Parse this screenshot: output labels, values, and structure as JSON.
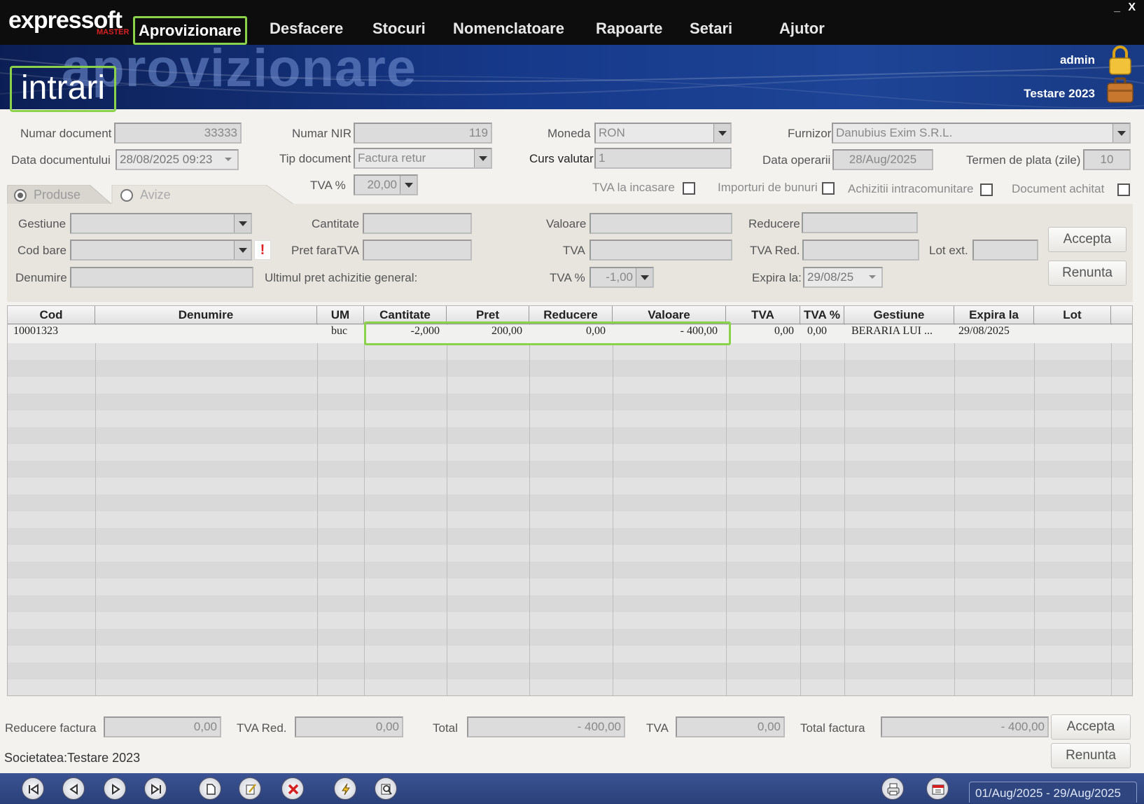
{
  "app": {
    "logo": "expressoft",
    "logo_sub": "MASTER",
    "window_min": "_",
    "window_close": "X"
  },
  "menu": {
    "items": [
      "Aprovizionare",
      "Desfacere",
      "Stocuri",
      "Nomenclatoare",
      "Rapoarte",
      "Setari",
      "Ajutor"
    ],
    "active": "Aprovizionare"
  },
  "banner": {
    "bg_title": "aprovizionare",
    "section_title": "intrari",
    "user": "admin",
    "company": "Testare 2023"
  },
  "header_form": {
    "numar_document": {
      "label": "Numar document",
      "value": "33333"
    },
    "numar_nir": {
      "label": "Numar NIR",
      "value": "119"
    },
    "moneda": {
      "label": "Moneda",
      "value": "RON"
    },
    "furnizor": {
      "label": "Furnizor",
      "value": "Danubius Exim S.R.L."
    },
    "data_documentului": {
      "label": "Data documentului",
      "value": "28/08/2025 09:23"
    },
    "tip_document": {
      "label": "Tip document",
      "value": "Factura retur"
    },
    "curs_valutar": {
      "label": "Curs valutar",
      "value": "1"
    },
    "data_operarii": {
      "label": "Data operarii",
      "value": "28/Aug/2025"
    },
    "termen_plata": {
      "label": "Termen de plata (zile)",
      "value": "10"
    },
    "tva_pct": {
      "label": "TVA %",
      "value": "20,00"
    },
    "checkboxes": [
      {
        "label": "TVA la incasare",
        "checked": false
      },
      {
        "label": "Importuri de bunuri",
        "checked": false
      },
      {
        "label": "Achizitii intracomunitare",
        "checked": false
      },
      {
        "label": "Document achitat",
        "checked": false
      }
    ]
  },
  "tabs": [
    {
      "label": "Produse",
      "selected": true
    },
    {
      "label": "Avize",
      "selected": false
    }
  ],
  "detail_form": {
    "gestiune_label": "Gestiune",
    "cod_bare_label": "Cod bare",
    "cod_bare_warning": "!",
    "denumire_label": "Denumire",
    "cantitate_label": "Cantitate",
    "pret_fara_tva_label": "Pret faraTVA",
    "ultimul_pret_label": "Ultimul pret achizitie general:",
    "valoare_label": "Valoare",
    "tva_label": "TVA",
    "tva_pct_label": "TVA %",
    "tva_pct_value": "-1,00",
    "reducere_label": "Reducere",
    "tva_red_label": "TVA Red.",
    "lot_ext_label": "Lot ext.",
    "expira_label": "Expira la:",
    "expira_value": "29/08/25",
    "accept_button": "Accepta",
    "cancel_button": "Renunta"
  },
  "grid": {
    "columns": [
      "Cod",
      "Denumire",
      "UM",
      "Cantitate",
      "Pret",
      "Reducere",
      "Valoare",
      "TVA",
      "TVA %",
      "Gestiune",
      "Expira la",
      "Lot"
    ],
    "rows": [
      {
        "cod": "10001323",
        "denumire": "",
        "um": "buc",
        "cantitate": "-2,000",
        "pret": "200,00",
        "reducere": "0,00",
        "valoare": "- 400,00",
        "tva": "0,00",
        "tva_pct": "0,00",
        "gestiune": "BERARIA LUI ...",
        "expira_la": "29/08/2025",
        "lot": ""
      }
    ]
  },
  "totals": {
    "reducere_factura": {
      "label": "Reducere factura",
      "value": "0,00"
    },
    "tva_red": {
      "label": "TVA Red.",
      "value": "0,00"
    },
    "total": {
      "label": "Total",
      "value": "- 400,00"
    },
    "tva": {
      "label": "TVA",
      "value": "0,00"
    },
    "total_factura": {
      "label": "Total factura",
      "value": "- 400,00"
    },
    "accept_button": "Accepta",
    "cancel_button": "Renunta"
  },
  "footer": {
    "company_line": "Societatea:Testare 2023",
    "period": "01/Aug/2025 - 29/Aug/2025",
    "toolbar_icons": [
      "first-record-icon",
      "previous-record-icon",
      "next-record-icon",
      "last-record-icon",
      "new-document-icon",
      "edit-icon",
      "delete-icon",
      "quick-action-icon",
      "search-icon",
      "print-icon",
      "calendar-icon"
    ]
  },
  "colors": {
    "highlight": "#8ad24a",
    "banner_dark": "#0c1f55",
    "toolbar": "#2a407a",
    "delete_red": "#d42020"
  }
}
